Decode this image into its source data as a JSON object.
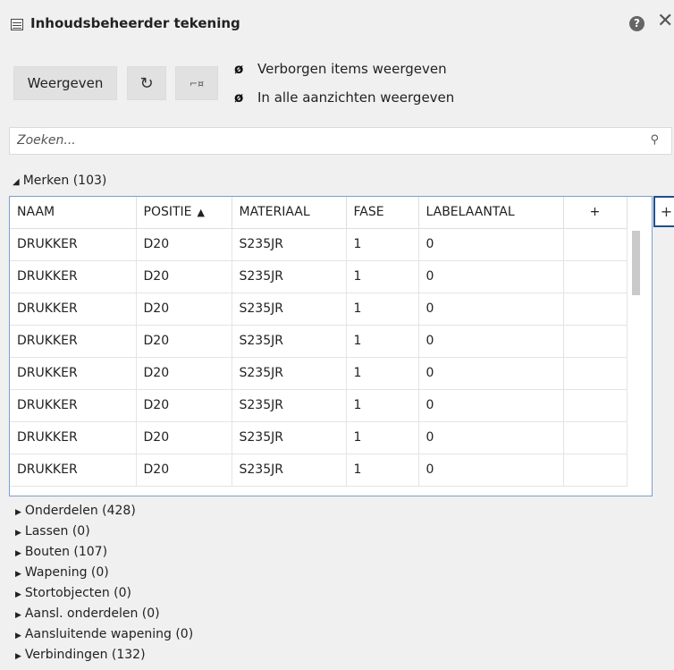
{
  "title": "Inhoudsbeheerder tekening",
  "help_glyph": "?",
  "close_glyph": "✕",
  "toolbar": {
    "show_button": "Weergeven",
    "refresh_glyph": "↻",
    "extra_glyph": "⌐¤",
    "option_hidden": "Verborgen items weergeven",
    "option_all_views": "In alle aanzichten weergeven",
    "eye_glyph": "ø"
  },
  "search": {
    "placeholder": "Zoeken...",
    "icon_glyph": "⚲"
  },
  "expanded_group": {
    "label": "Merken (103)",
    "glyph": "◢"
  },
  "table": {
    "columns": [
      "NAAM",
      "POSITIE",
      "MATERIAAL",
      "FASE",
      "LABELAANTAL",
      "+"
    ],
    "sort_glyph": "▲",
    "rows": [
      [
        "DRUKKER",
        "D20",
        "S235JR",
        "1",
        "0"
      ],
      [
        "DRUKKER",
        "D20",
        "S235JR",
        "1",
        "0"
      ],
      [
        "DRUKKER",
        "D20",
        "S235JR",
        "1",
        "0"
      ],
      [
        "DRUKKER",
        "D20",
        "S235JR",
        "1",
        "0"
      ],
      [
        "DRUKKER",
        "D20",
        "S235JR",
        "1",
        "0"
      ],
      [
        "DRUKKER",
        "D20",
        "S235JR",
        "1",
        "0"
      ],
      [
        "DRUKKER",
        "D20",
        "S235JR",
        "1",
        "0"
      ],
      [
        "DRUKKER",
        "D20",
        "S235JR",
        "1",
        "0"
      ]
    ]
  },
  "add_column_glyph": "+",
  "collapsed_glyph": "▶",
  "groups": [
    "Onderdelen (428)",
    "Lassen (0)",
    "Bouten (107)",
    "Wapening (0)",
    "Stortobjecten (0)",
    "Aansl. onderdelen (0)",
    "Aansluitende wapening (0)",
    "Verbindingen (132)"
  ],
  "colors": {
    "background": "#f0f0f0",
    "table_border": "#7a9fcf",
    "focus_border": "#1f4e8c",
    "button": "#e1e1e1"
  }
}
